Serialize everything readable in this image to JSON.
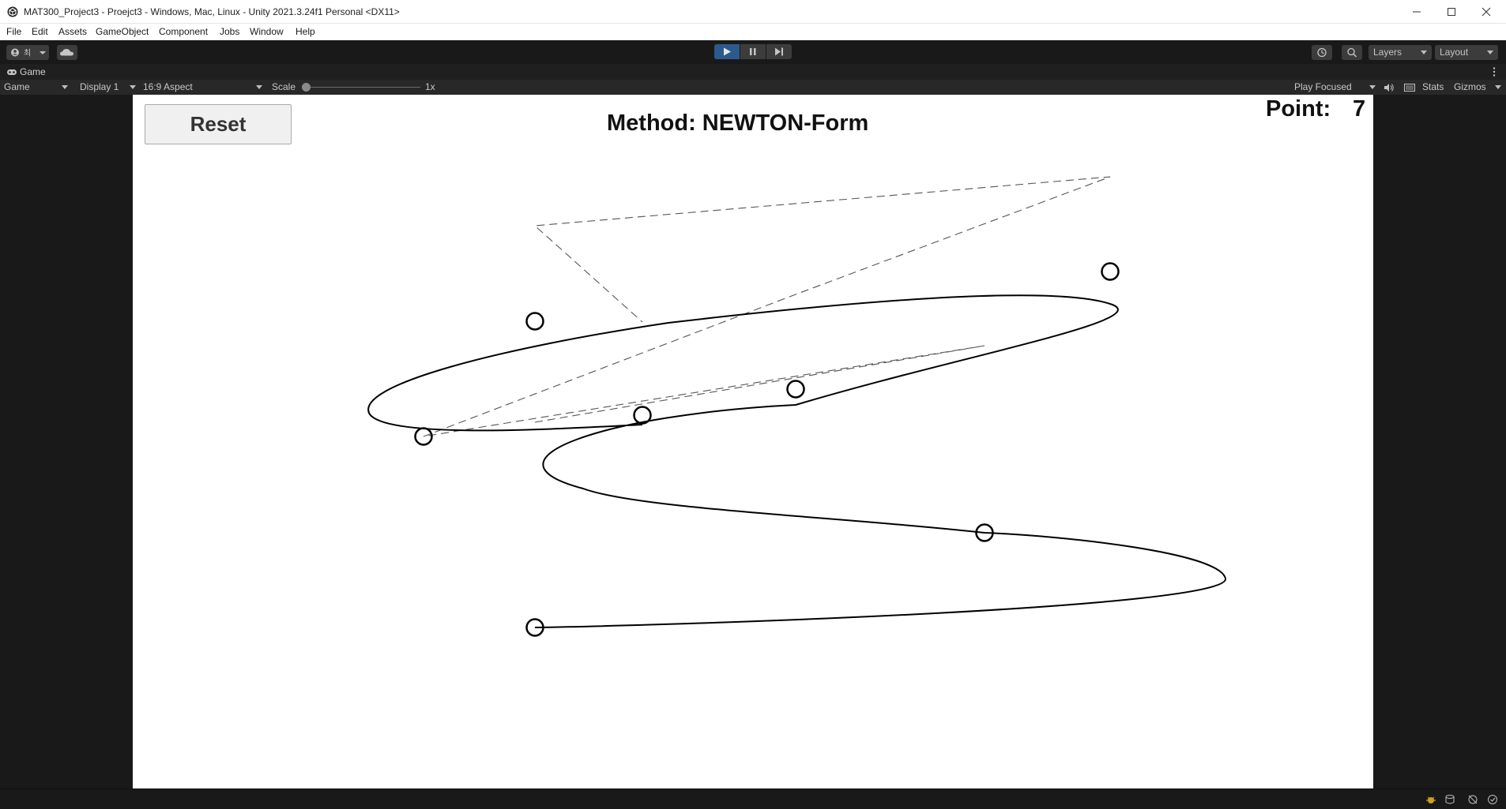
{
  "window": {
    "title": "MAT300_Project3 - Proejct3 - Windows, Mac, Linux - Unity 2021.3.24f1 Personal <DX11>"
  },
  "menu": {
    "items": [
      "File",
      "Edit",
      "Assets",
      "GameObject",
      "Component",
      "Jobs",
      "Window",
      "Help"
    ]
  },
  "toolbar": {
    "account_label": "최",
    "layers_label": "Layers",
    "layout_label": "Layout"
  },
  "tab": {
    "label": "Game"
  },
  "game_bar": {
    "view_select": "Game",
    "display_select": "Display 1",
    "aspect_select": "16:9 Aspect",
    "scale_label": "Scale",
    "scale_value": "1x",
    "scale_fraction": 0.0,
    "play_mode_select": "Play Focused",
    "stats_label": "Stats",
    "gizmos_label": "Gizmos"
  },
  "game": {
    "reset_label": "Reset",
    "method_text": "Method: NEWTON-Form",
    "point_label": "Point:",
    "point_value": "7"
  },
  "colors": {
    "play_active": "#2d5a8c",
    "editor_bg": "#191919",
    "game_bg": "#ffffff",
    "curve": "#000000"
  }
}
